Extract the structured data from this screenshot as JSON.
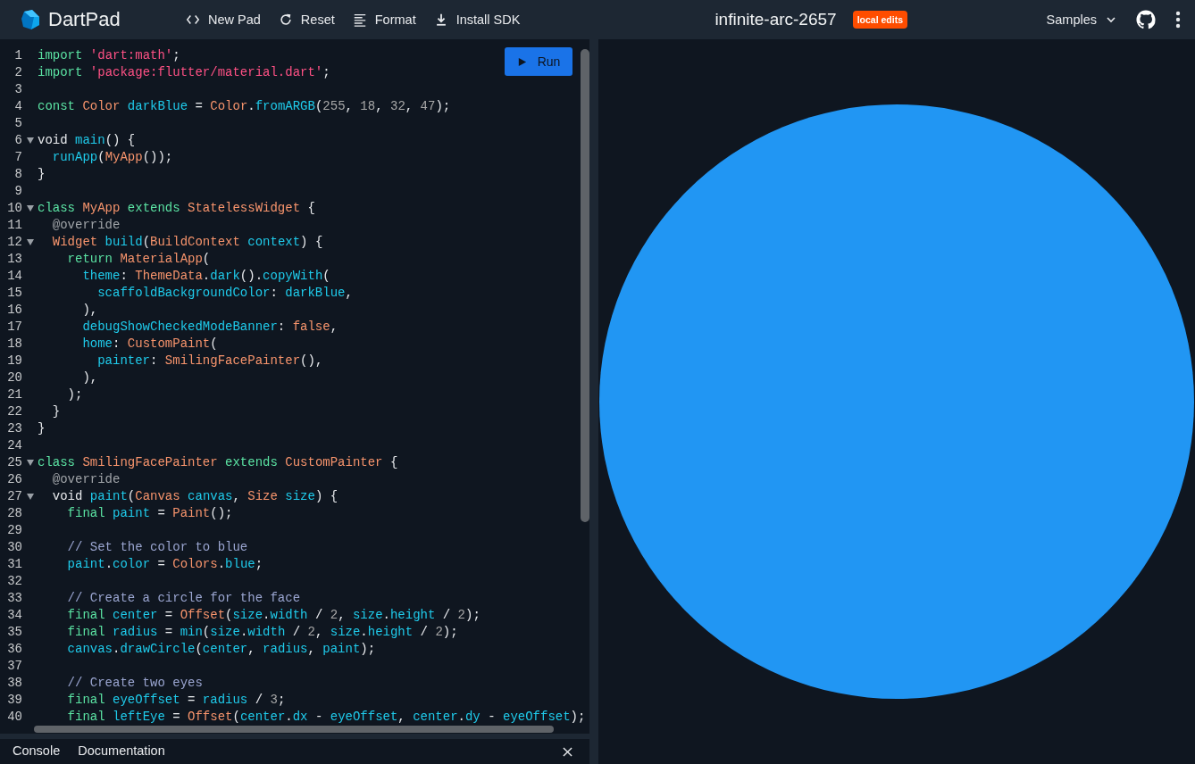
{
  "app_bar": {
    "logo_text": "DartPad",
    "actions": [
      {
        "kind": "code",
        "label": "New Pad"
      },
      {
        "kind": "refresh",
        "label": "Reset"
      },
      {
        "kind": "format",
        "label": "Format"
      },
      {
        "kind": "download",
        "label": "Install SDK"
      }
    ],
    "title": "infinite-arc-2657",
    "badge": "local edits",
    "samples": "Samples"
  },
  "editor": {
    "run_label": "Run",
    "lines": [
      {
        "n": "1",
        "fold": false,
        "tokens": [
          {
            "kind": "kw",
            "text": "import"
          },
          {
            "kind": "str",
            "text": " 'dart:math'"
          },
          {
            "kind": "plain",
            "text": ";"
          }
        ]
      },
      {
        "n": "2",
        "fold": false,
        "tokens": [
          {
            "kind": "kw",
            "text": "import"
          },
          {
            "kind": "str",
            "text": " 'package:flutter/material.dart'"
          },
          {
            "kind": "plain",
            "text": ";"
          }
        ]
      },
      {
        "n": "3",
        "fold": false
      },
      {
        "n": "4",
        "fold": false,
        "tokens": [
          {
            "kind": "kw",
            "text": "const"
          },
          {
            "kind": "type",
            "text": " Color"
          },
          {
            "kind": "id",
            "text": " darkBlue"
          },
          {
            "kind": "plain",
            "text": " ="
          },
          {
            "kind": "type",
            "text": " Color"
          },
          {
            "kind": "plain",
            "text": "."
          },
          {
            "kind": "id",
            "text": "fromARGB"
          },
          {
            "kind": "plain",
            "text": "("
          },
          {
            "kind": "num",
            "text": "255"
          },
          {
            "kind": "plain",
            "text": ","
          },
          {
            "kind": "num",
            "text": " 18"
          },
          {
            "kind": "plain",
            "text": ","
          },
          {
            "kind": "num",
            "text": " 32"
          },
          {
            "kind": "plain",
            "text": ","
          },
          {
            "kind": "num",
            "text": " 47"
          },
          {
            "kind": "plain",
            "text": ");"
          }
        ]
      },
      {
        "n": "5",
        "fold": false
      },
      {
        "n": "6",
        "fold": true,
        "tokens": [
          {
            "kind": "plain",
            "text": "void"
          },
          {
            "kind": "id",
            "text": " main"
          },
          {
            "kind": "plain",
            "text": "() {"
          }
        ]
      },
      {
        "n": "7",
        "fold": false,
        "tokens": [
          {
            "kind": "id",
            "text": "  runApp"
          },
          {
            "kind": "plain",
            "text": "("
          },
          {
            "kind": "type",
            "text": "MyApp"
          },
          {
            "kind": "plain",
            "text": "());"
          }
        ]
      },
      {
        "n": "8",
        "fold": false,
        "tokens": [
          {
            "kind": "plain",
            "text": "}"
          }
        ]
      },
      {
        "n": "9",
        "fold": false
      },
      {
        "n": "10",
        "fold": true,
        "tokens": [
          {
            "kind": "kw",
            "text": "class"
          },
          {
            "kind": "type",
            "text": " MyApp"
          },
          {
            "kind": "kw",
            "text": " extends"
          },
          {
            "kind": "type",
            "text": " StatelessWidget"
          },
          {
            "kind": "plain",
            "text": " {"
          }
        ]
      },
      {
        "n": "11",
        "fold": false,
        "tokens": [
          {
            "kind": "ann",
            "text": "  @override"
          }
        ]
      },
      {
        "n": "12",
        "fold": true,
        "tokens": [
          {
            "kind": "type",
            "text": "  Widget"
          },
          {
            "kind": "id",
            "text": " build"
          },
          {
            "kind": "plain",
            "text": "("
          },
          {
            "kind": "type",
            "text": "BuildContext"
          },
          {
            "kind": "id",
            "text": " context"
          },
          {
            "kind": "plain",
            "text": ") {"
          }
        ]
      },
      {
        "n": "13",
        "fold": false,
        "tokens": [
          {
            "kind": "kw",
            "text": "    return"
          },
          {
            "kind": "type",
            "text": " MaterialApp"
          },
          {
            "kind": "plain",
            "text": "("
          }
        ]
      },
      {
        "n": "14",
        "fold": false,
        "tokens": [
          {
            "kind": "id",
            "text": "      theme"
          },
          {
            "kind": "plain",
            "text": ":"
          },
          {
            "kind": "type",
            "text": " ThemeData"
          },
          {
            "kind": "plain",
            "text": "."
          },
          {
            "kind": "id",
            "text": "dark"
          },
          {
            "kind": "plain",
            "text": "()."
          },
          {
            "kind": "id",
            "text": "copyWith"
          },
          {
            "kind": "plain",
            "text": "("
          }
        ]
      },
      {
        "n": "15",
        "fold": false,
        "tokens": [
          {
            "kind": "id",
            "text": "        scaffoldBackgroundColor"
          },
          {
            "kind": "plain",
            "text": ":"
          },
          {
            "kind": "id",
            "text": " darkBlue"
          },
          {
            "kind": "plain",
            "text": ","
          }
        ]
      },
      {
        "n": "16",
        "fold": false,
        "tokens": [
          {
            "kind": "plain",
            "text": "      ),"
          }
        ]
      },
      {
        "n": "17",
        "fold": false,
        "tokens": [
          {
            "kind": "id",
            "text": "      debugShowCheckedModeBanner"
          },
          {
            "kind": "plain",
            "text": ":"
          },
          {
            "kind": "type",
            "text": " false"
          },
          {
            "kind": "plain",
            "text": ","
          }
        ]
      },
      {
        "n": "18",
        "fold": false,
        "tokens": [
          {
            "kind": "id",
            "text": "      home"
          },
          {
            "kind": "plain",
            "text": ":"
          },
          {
            "kind": "type",
            "text": " CustomPaint"
          },
          {
            "kind": "plain",
            "text": "("
          }
        ]
      },
      {
        "n": "19",
        "fold": false,
        "tokens": [
          {
            "kind": "id",
            "text": "        painter"
          },
          {
            "kind": "plain",
            "text": ":"
          },
          {
            "kind": "type",
            "text": " SmilingFacePainter"
          },
          {
            "kind": "plain",
            "text": "(),"
          }
        ]
      },
      {
        "n": "20",
        "fold": false,
        "tokens": [
          {
            "kind": "plain",
            "text": "      ),"
          }
        ]
      },
      {
        "n": "21",
        "fold": false,
        "tokens": [
          {
            "kind": "plain",
            "text": "    );"
          }
        ]
      },
      {
        "n": "22",
        "fold": false,
        "tokens": [
          {
            "kind": "plain",
            "text": "  }"
          }
        ]
      },
      {
        "n": "23",
        "fold": false,
        "tokens": [
          {
            "kind": "plain",
            "text": "}"
          }
        ]
      },
      {
        "n": "24",
        "fold": false
      },
      {
        "n": "25",
        "fold": true,
        "tokens": [
          {
            "kind": "kw",
            "text": "class"
          },
          {
            "kind": "type",
            "text": " SmilingFacePainter"
          },
          {
            "kind": "kw",
            "text": " extends"
          },
          {
            "kind": "type",
            "text": " CustomPainter"
          },
          {
            "kind": "plain",
            "text": " {"
          }
        ]
      },
      {
        "n": "26",
        "fold": false,
        "tokens": [
          {
            "kind": "ann",
            "text": "  @override"
          }
        ]
      },
      {
        "n": "27",
        "fold": true,
        "tokens": [
          {
            "kind": "plain",
            "text": "  void"
          },
          {
            "kind": "id",
            "text": " paint"
          },
          {
            "kind": "plain",
            "text": "("
          },
          {
            "kind": "type",
            "text": "Canvas"
          },
          {
            "kind": "id",
            "text": " canvas"
          },
          {
            "kind": "plain",
            "text": ","
          },
          {
            "kind": "type",
            "text": " Size"
          },
          {
            "kind": "id",
            "text": " size"
          },
          {
            "kind": "plain",
            "text": ") {"
          }
        ]
      },
      {
        "n": "28",
        "fold": false,
        "tokens": [
          {
            "kind": "kw",
            "text": "    final"
          },
          {
            "kind": "id",
            "text": " paint"
          },
          {
            "kind": "plain",
            "text": " ="
          },
          {
            "kind": "type",
            "text": " Paint"
          },
          {
            "kind": "plain",
            "text": "();"
          }
        ]
      },
      {
        "n": "29",
        "fold": false
      },
      {
        "n": "30",
        "fold": false,
        "tokens": [
          {
            "kind": "com",
            "text": "    // Set the color to blue"
          }
        ]
      },
      {
        "n": "31",
        "fold": false,
        "tokens": [
          {
            "kind": "id",
            "text": "    paint"
          },
          {
            "kind": "plain",
            "text": "."
          },
          {
            "kind": "id",
            "text": "color"
          },
          {
            "kind": "plain",
            "text": " ="
          },
          {
            "kind": "type",
            "text": " Colors"
          },
          {
            "kind": "plain",
            "text": "."
          },
          {
            "kind": "id",
            "text": "blue"
          },
          {
            "kind": "plain",
            "text": ";"
          }
        ]
      },
      {
        "n": "32",
        "fold": false
      },
      {
        "n": "33",
        "fold": false,
        "tokens": [
          {
            "kind": "com",
            "text": "    // Create a circle for the face"
          }
        ]
      },
      {
        "n": "34",
        "fold": false,
        "tokens": [
          {
            "kind": "kw",
            "text": "    final"
          },
          {
            "kind": "id",
            "text": " center"
          },
          {
            "kind": "plain",
            "text": " ="
          },
          {
            "kind": "type",
            "text": " Offset"
          },
          {
            "kind": "plain",
            "text": "("
          },
          {
            "kind": "id",
            "text": "size"
          },
          {
            "kind": "plain",
            "text": "."
          },
          {
            "kind": "id",
            "text": "width"
          },
          {
            "kind": "plain",
            "text": " /"
          },
          {
            "kind": "num",
            "text": " 2"
          },
          {
            "kind": "plain",
            "text": ","
          },
          {
            "kind": "id",
            "text": " size"
          },
          {
            "kind": "plain",
            "text": "."
          },
          {
            "kind": "id",
            "text": "height"
          },
          {
            "kind": "plain",
            "text": " /"
          },
          {
            "kind": "num",
            "text": " 2"
          },
          {
            "kind": "plain",
            "text": ");"
          }
        ]
      },
      {
        "n": "35",
        "fold": false,
        "tokens": [
          {
            "kind": "kw",
            "text": "    final"
          },
          {
            "kind": "id",
            "text": " radius"
          },
          {
            "kind": "plain",
            "text": " ="
          },
          {
            "kind": "id",
            "text": " min"
          },
          {
            "kind": "plain",
            "text": "("
          },
          {
            "kind": "id",
            "text": "size"
          },
          {
            "kind": "plain",
            "text": "."
          },
          {
            "kind": "id",
            "text": "width"
          },
          {
            "kind": "plain",
            "text": " /"
          },
          {
            "kind": "num",
            "text": " 2"
          },
          {
            "kind": "plain",
            "text": ","
          },
          {
            "kind": "id",
            "text": " size"
          },
          {
            "kind": "plain",
            "text": "."
          },
          {
            "kind": "id",
            "text": "height"
          },
          {
            "kind": "plain",
            "text": " /"
          },
          {
            "kind": "num",
            "text": " 2"
          },
          {
            "kind": "plain",
            "text": ");"
          }
        ]
      },
      {
        "n": "36",
        "fold": false,
        "tokens": [
          {
            "kind": "id",
            "text": "    canvas"
          },
          {
            "kind": "plain",
            "text": "."
          },
          {
            "kind": "id",
            "text": "drawCircle"
          },
          {
            "kind": "plain",
            "text": "("
          },
          {
            "kind": "id",
            "text": "center"
          },
          {
            "kind": "plain",
            "text": ","
          },
          {
            "kind": "id",
            "text": " radius"
          },
          {
            "kind": "plain",
            "text": ","
          },
          {
            "kind": "id",
            "text": " paint"
          },
          {
            "kind": "plain",
            "text": ");"
          }
        ]
      },
      {
        "n": "37",
        "fold": false
      },
      {
        "n": "38",
        "fold": false,
        "tokens": [
          {
            "kind": "com",
            "text": "    // Create two eyes"
          }
        ]
      },
      {
        "n": "39",
        "fold": false,
        "tokens": [
          {
            "kind": "kw",
            "text": "    final"
          },
          {
            "kind": "id",
            "text": " eyeOffset"
          },
          {
            "kind": "plain",
            "text": " ="
          },
          {
            "kind": "id",
            "text": " radius"
          },
          {
            "kind": "plain",
            "text": " /"
          },
          {
            "kind": "num",
            "text": " 3"
          },
          {
            "kind": "plain",
            "text": ";"
          }
        ]
      },
      {
        "n": "40",
        "fold": false,
        "tokens": [
          {
            "kind": "kw",
            "text": "    final"
          },
          {
            "kind": "id",
            "text": " leftEye"
          },
          {
            "kind": "plain",
            "text": " ="
          },
          {
            "kind": "type",
            "text": " Offset"
          },
          {
            "kind": "plain",
            "text": "("
          },
          {
            "kind": "id",
            "text": "center"
          },
          {
            "kind": "plain",
            "text": "."
          },
          {
            "kind": "id",
            "text": "dx"
          },
          {
            "kind": "plain",
            "text": " -"
          },
          {
            "kind": "id",
            "text": " eyeOffset"
          },
          {
            "kind": "plain",
            "text": ","
          },
          {
            "kind": "id",
            "text": " center"
          },
          {
            "kind": "plain",
            "text": "."
          },
          {
            "kind": "id",
            "text": "dy"
          },
          {
            "kind": "plain",
            "text": " -"
          },
          {
            "kind": "id",
            "text": " eyeOffset"
          },
          {
            "kind": "plain",
            "text": ");"
          }
        ]
      }
    ]
  },
  "bottom_tabs": [
    {
      "label": "Console",
      "selected": false
    },
    {
      "label": "Documentation",
      "selected": false
    }
  ],
  "preview": {
    "kind": "circle"
  }
}
